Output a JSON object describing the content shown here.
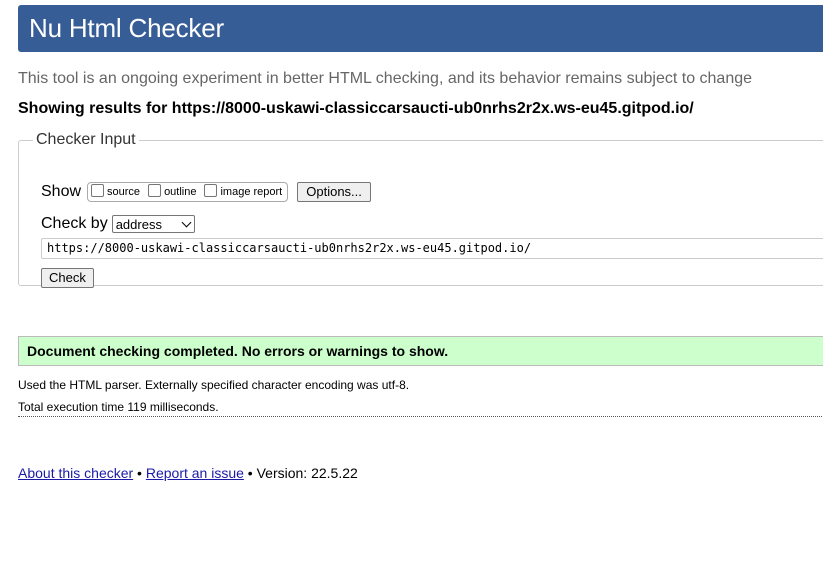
{
  "header": {
    "title": "Nu Html Checker"
  },
  "tagline": "This tool is an ongoing experiment in better HTML checking, and its behavior remains subject to change",
  "results_for": {
    "prefix": "Showing results for ",
    "url": "https://8000-uskawi-classiccarsaucti-ub0nrhs2r2x.ws-eu45.gitpod.io/"
  },
  "checker_input": {
    "legend": "Checker Input",
    "show_label": "Show",
    "show_options": [
      {
        "label": "source",
        "checked": false
      },
      {
        "label": "outline",
        "checked": false
      },
      {
        "label": "image report",
        "checked": false
      }
    ],
    "options_button": "Options...",
    "check_by_label": "Check by",
    "check_by_value": "address",
    "url_value": "https://8000-uskawi-classiccarsaucti-ub0nrhs2r2x.ws-eu45.gitpod.io/",
    "check_button": "Check"
  },
  "result": {
    "message": "Document checking completed. No errors or warnings to show.",
    "color": "#ccffcc"
  },
  "details": {
    "parser": "Used the HTML parser. Externally specified character encoding was utf-8.",
    "time": "Total execution time 119 milliseconds."
  },
  "footer": {
    "about_link": "About this checker",
    "sep1": " • ",
    "report_link": "Report an issue",
    "version": " • Version: 22.5.22"
  },
  "colors": {
    "banner": "#365d95",
    "link": "#1a1aa6"
  }
}
